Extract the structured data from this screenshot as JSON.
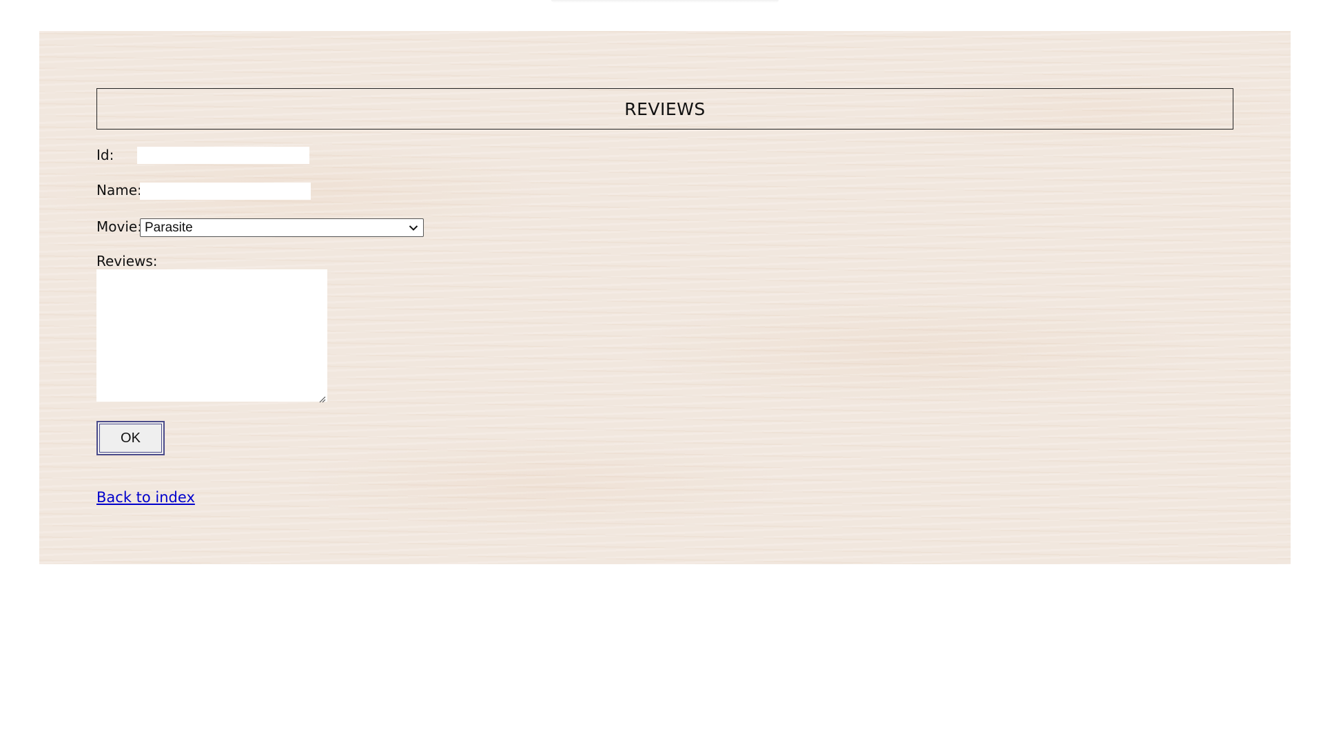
{
  "form": {
    "title": "REVIEWS",
    "id_label": "Id:",
    "id_value": "",
    "name_label": "Name:",
    "name_value": "",
    "movie_label": "Movie:",
    "movie_selected": "Parasite",
    "reviews_label": "Reviews:",
    "reviews_value": "",
    "ok_label": "OK",
    "back_link": "Back to index"
  },
  "icons": {
    "select_arrow": "chevron-down-icon",
    "resize": "resize-grip-icon"
  },
  "colors": {
    "panel_background": "#f1e7de",
    "link": "#0000cc",
    "button_border": "#4a4a8a"
  }
}
